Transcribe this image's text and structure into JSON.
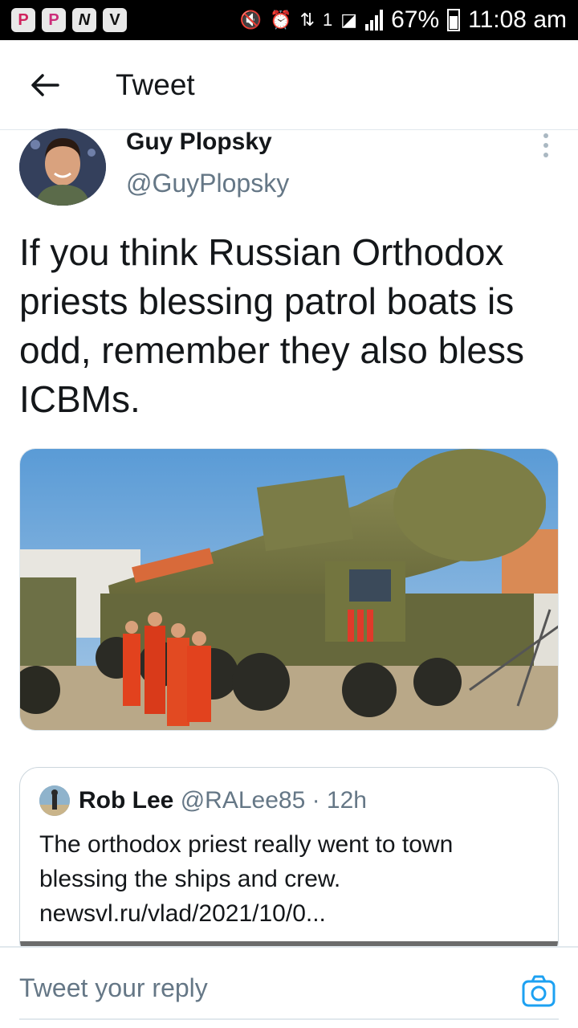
{
  "status_bar": {
    "battery": "67%",
    "time": "11:08 am",
    "sim_label": "1"
  },
  "header": {
    "title": "Tweet"
  },
  "tweet": {
    "author_name": "Guy Plopsky",
    "author_handle": "@GuyPlopsky",
    "text": "If you think Russian Orthodox priests blessing patrol boats is odd, remember they also bless ICBMs."
  },
  "quoted_tweet": {
    "author_name": "Rob Lee",
    "meta": "@RALee85 · 12h",
    "text": "The orthodox priest really went to town blessing the ships and crew.",
    "link": "newsvl.ru/vlad/2021/10/0..."
  },
  "reply": {
    "placeholder": "Tweet your reply"
  },
  "colors": {
    "accent": "#1da1f2",
    "muted": "#657786",
    "border": "#e1e8ed"
  }
}
